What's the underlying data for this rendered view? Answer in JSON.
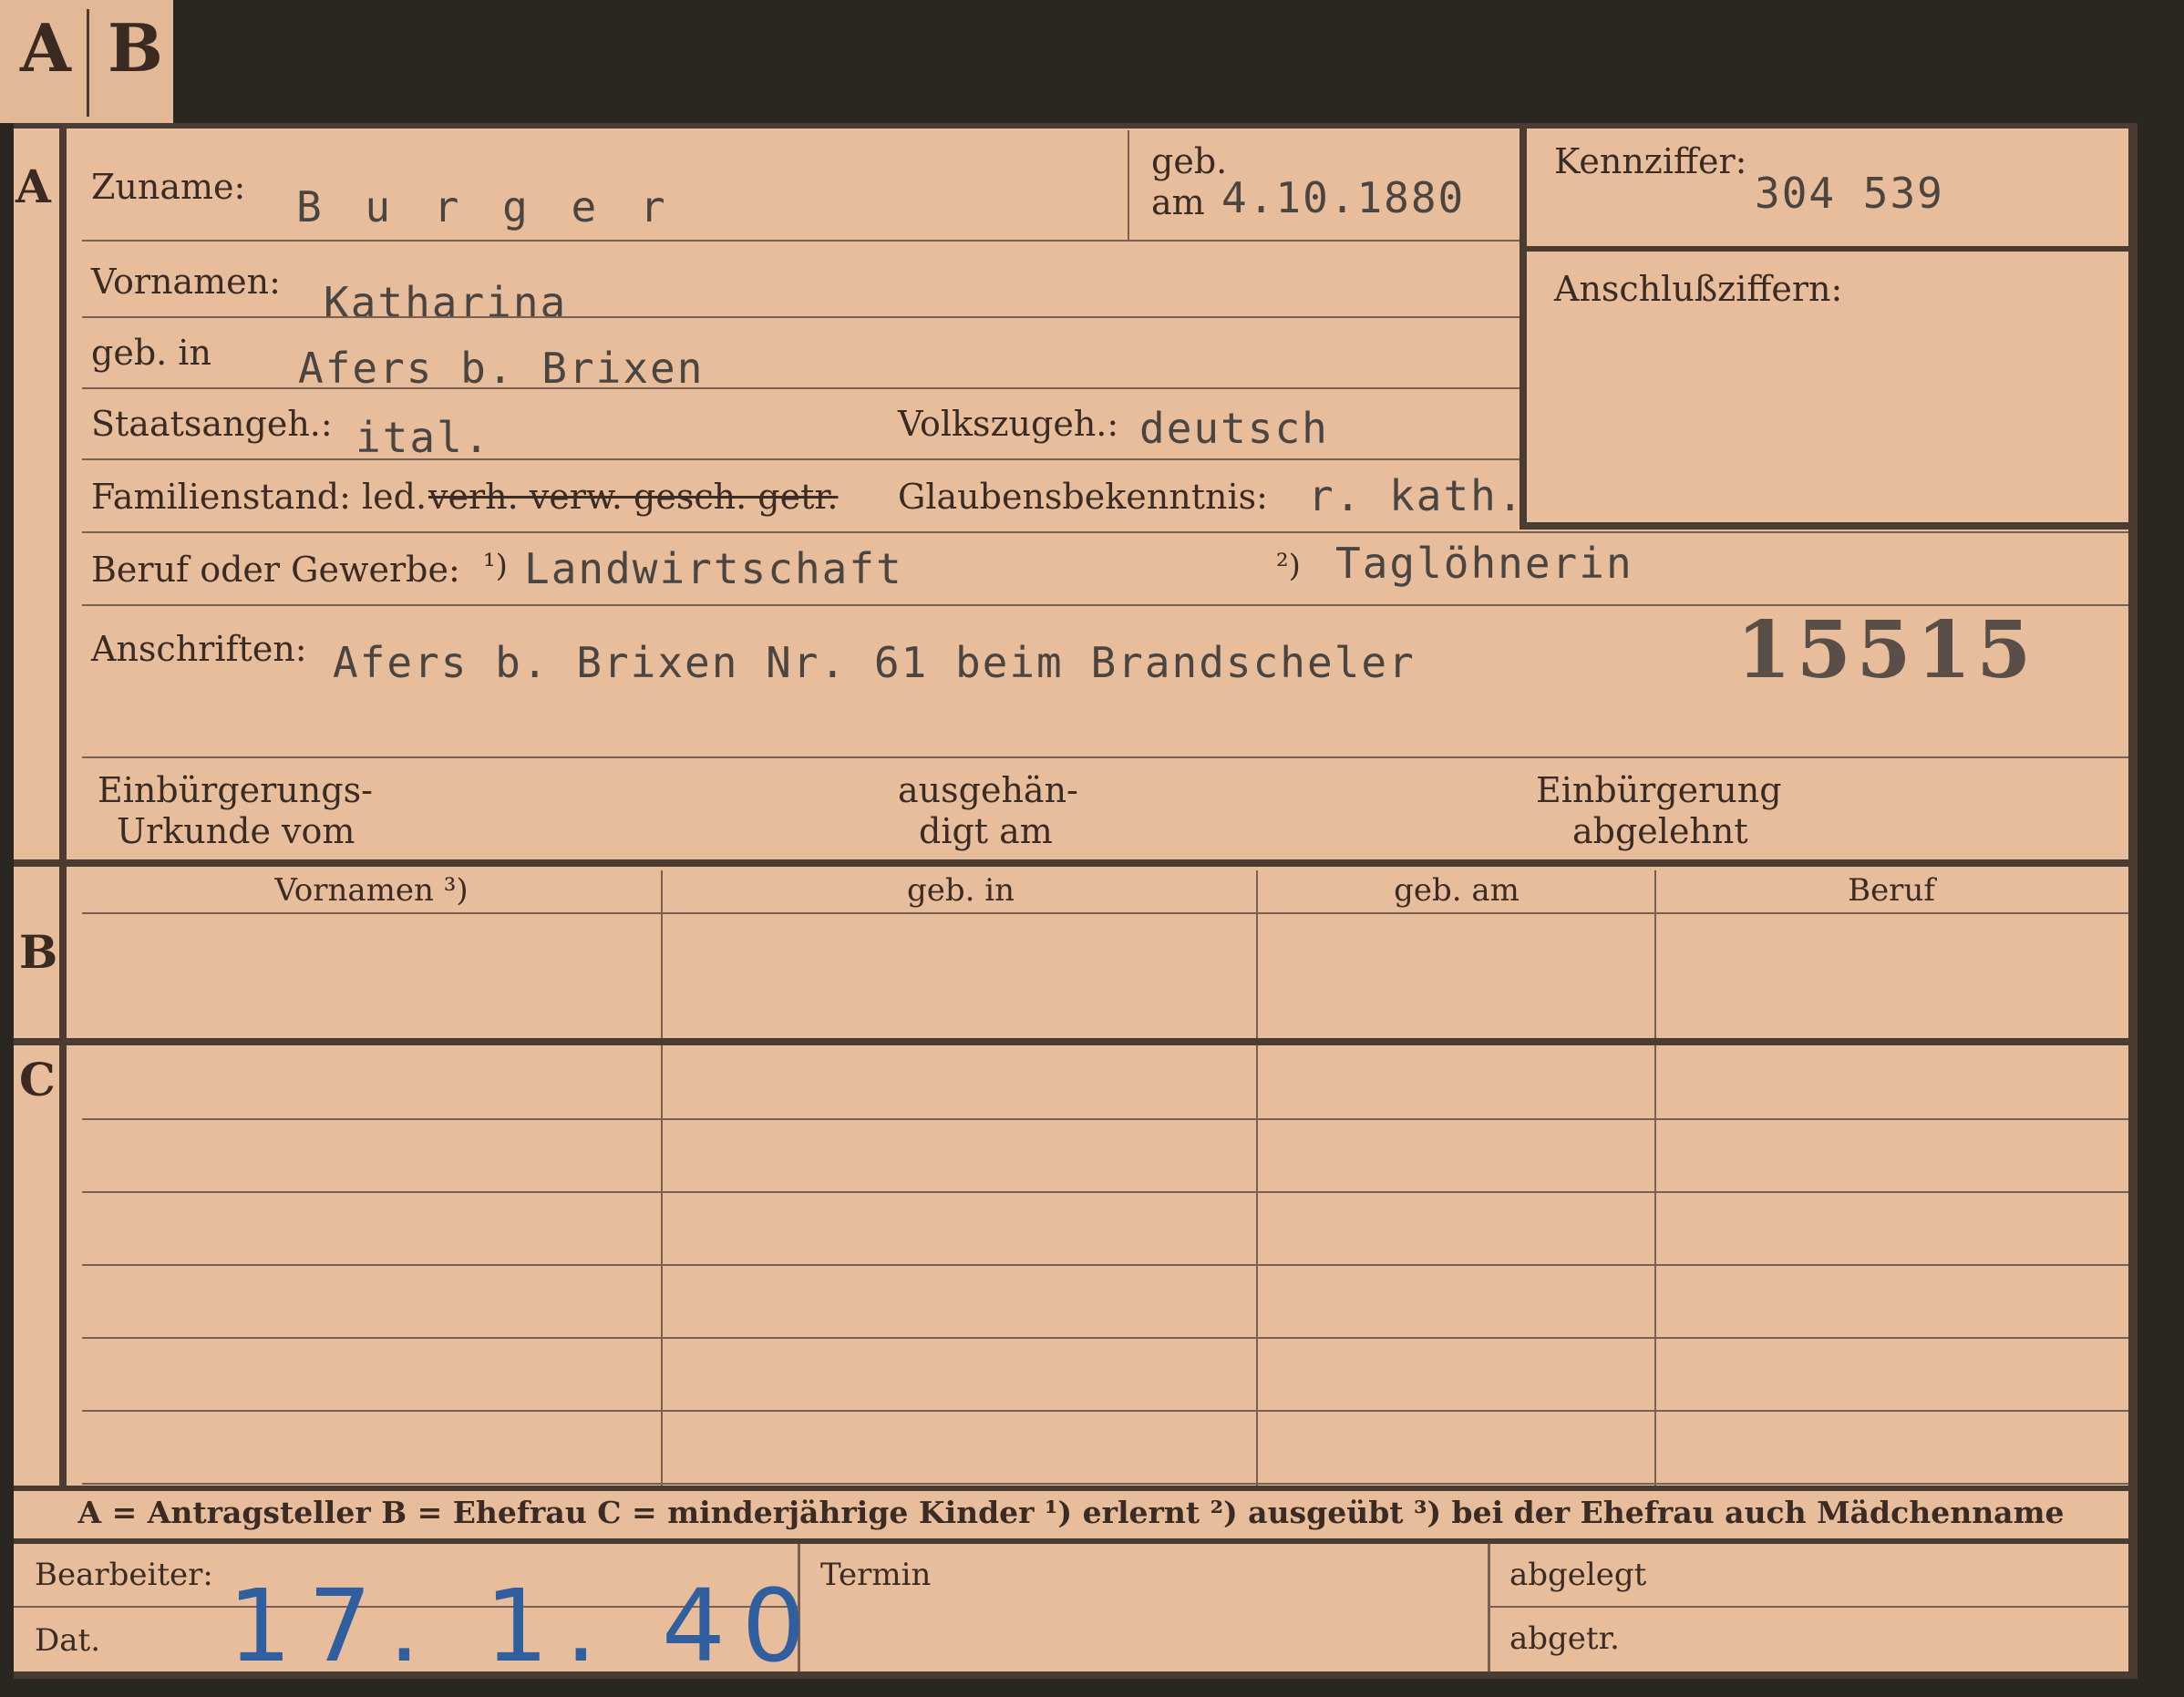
{
  "tabs": {
    "a": "A",
    "b": "B"
  },
  "sections": {
    "a": "A",
    "b": "B",
    "c": "C"
  },
  "labels": {
    "zuname": "Zuname:",
    "geb": "geb.",
    "am": "am",
    "kennziffer": "Kennziffer:",
    "anschlussziffern": "Anschlußziffern:",
    "vornamen": "Vornamen:",
    "geb_in": "geb. in",
    "staatsangeh": "Staatsangeh.:",
    "volkszugeh": "Volkszugeh.:",
    "familienstand": "Familienstand: led.",
    "familienstand_struck": "verh. verw. gesch. getr.",
    "glaubensbekenntnis": "Glaubensbekenntnis:",
    "beruf": "Beruf oder Gewerbe:",
    "note1": "¹)",
    "note2": "²)",
    "anschriften": "Anschriften:",
    "einbuergerung_urkunde_1": "Einbürgerungs-",
    "einbuergerung_urkunde_2": "Urkunde vom",
    "ausgehaendigt_1": "ausgehän-",
    "ausgehaendigt_2": "digt am",
    "einbuergerung_abgelehnt_1": "Einbürgerung",
    "einbuergerung_abgelehnt_2": "abgelehnt"
  },
  "values": {
    "zuname": "B u r g e r",
    "geb_am": "4.10.1880",
    "kennziffer": "304 539",
    "vornamen": "Katharina",
    "geb_in": "Afers b. Brixen",
    "staatsangeh": "ital.",
    "volkszugeh": "deutsch",
    "glaubensbekenntnis": "r. kath.",
    "beruf_1": "Landwirtschaft",
    "beruf_2": "Taglöhnerin",
    "anschrift": "Afers b. Brixen Nr. 61 beim Brandscheler",
    "stamp_number": "15515"
  },
  "table": {
    "headers": [
      "Vornamen ³)",
      "geb. in",
      "geb. am",
      "Beruf"
    ]
  },
  "legend": "A = Antragsteller   B = Ehefrau   C = minderjährige Kinder   ¹) erlernt   ²) ausgeübt   ³) bei der Ehefrau auch Mädchenname",
  "footer": {
    "bearbeiter": "Bearbeiter:",
    "dat": "Dat.",
    "dat_value": "17. 1. 40",
    "termin": "Termin",
    "abgelegt": "abgelegt",
    "abgetr": "abgetr."
  },
  "colors": {
    "card": "#e7bd9b",
    "ink": "#3a2c24",
    "typewriter": "#4a4540",
    "handwriting": "#2f5f9e"
  }
}
